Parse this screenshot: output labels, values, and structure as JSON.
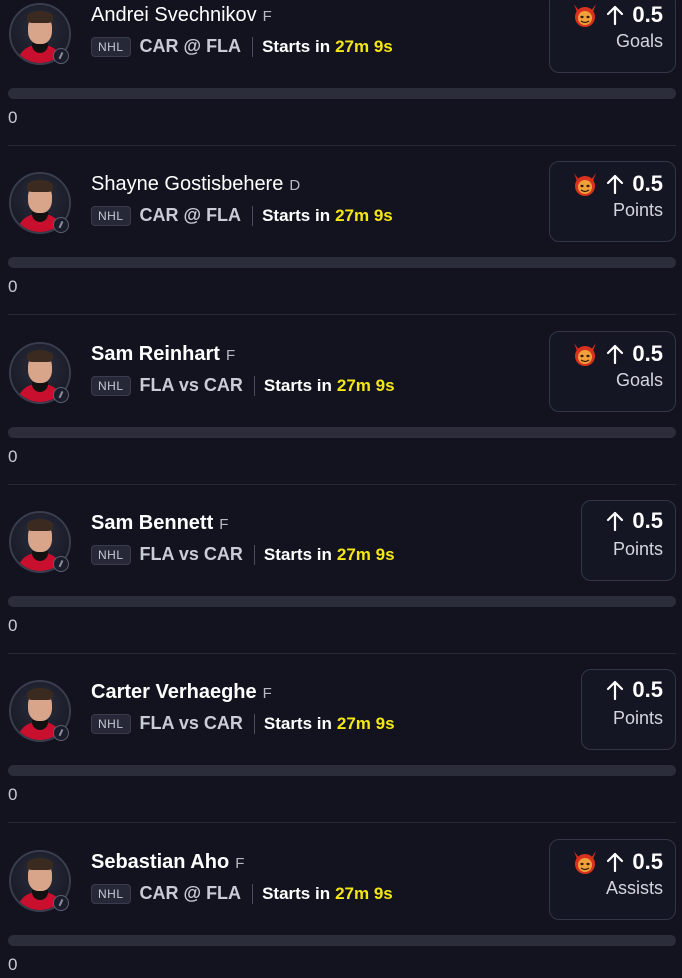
{
  "league": "NHL",
  "starts_label": "Starts in",
  "starts_time": "27m 9s",
  "picks": [
    {
      "name": "Andrei Svechnikov",
      "pos": "F",
      "matchup": "CAR @ FLA",
      "line": "0.5",
      "stat": "Goals",
      "demon": true,
      "progress": 0,
      "count": "0",
      "name_weight": "regular"
    },
    {
      "name": "Shayne Gostisbehere",
      "pos": "D",
      "matchup": "CAR @ FLA",
      "line": "0.5",
      "stat": "Points",
      "demon": true,
      "progress": 0,
      "count": "0",
      "name_weight": "regular"
    },
    {
      "name": "Sam Reinhart",
      "pos": "F",
      "matchup": "FLA vs CAR",
      "line": "0.5",
      "stat": "Goals",
      "demon": true,
      "progress": 0,
      "count": "0",
      "name_weight": "bold"
    },
    {
      "name": "Sam Bennett",
      "pos": "F",
      "matchup": "FLA vs CAR",
      "line": "0.5",
      "stat": "Points",
      "demon": false,
      "progress": 0,
      "count": "0",
      "name_weight": "bold"
    },
    {
      "name": "Carter Verhaeghe",
      "pos": "F",
      "matchup": "FLA vs CAR",
      "line": "0.5",
      "stat": "Points",
      "demon": false,
      "progress": 0,
      "count": "0",
      "name_weight": "bold"
    },
    {
      "name": "Sebastian Aho",
      "pos": "F",
      "matchup": "CAR @ FLA",
      "line": "0.5",
      "stat": "Assists",
      "demon": true,
      "progress": 0,
      "count": "0",
      "name_weight": "bold"
    }
  ],
  "icons": {
    "demon": "demon-icon",
    "arrow": "arrow-up-icon",
    "avatar_badge": "game-status-icon"
  },
  "colors": {
    "background": "#12131f",
    "accent_time": "#f4e714",
    "jersey": "#c8102e"
  }
}
